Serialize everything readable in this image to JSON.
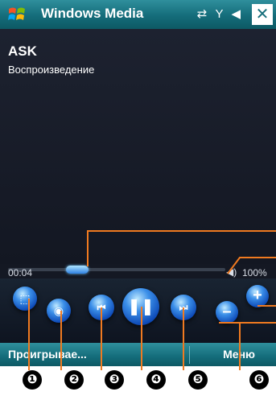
{
  "titlebar": {
    "title": "Windows Media",
    "start_icon": "windows-logo-icon",
    "status_icons": [
      "connectivity-icon",
      "signal-off-icon",
      "speaker-icon"
    ],
    "close_label": "✕"
  },
  "media": {
    "title": "ASK",
    "status": "Воспроизведение"
  },
  "seekbar": {
    "elapsed": "00:04",
    "position": 0.32
  },
  "volume": {
    "icon": "speaker-icon",
    "value": "100%"
  },
  "controls": [
    {
      "name": "fullscreen-icon",
      "glyph": "⬚"
    },
    {
      "name": "web-icon",
      "glyph": "◉"
    },
    {
      "name": "previous-track-icon",
      "glyph": "⏮"
    },
    {
      "name": "pause-icon",
      "glyph": "❚❚"
    },
    {
      "name": "next-track-icon",
      "glyph": "⏭"
    },
    {
      "name": "volume-down-icon",
      "glyph": "–"
    },
    {
      "name": "volume-up-icon",
      "glyph": "+"
    }
  ],
  "menubar": {
    "left": "Проигрывае...",
    "right": "Меню"
  },
  "callouts": [
    "❶",
    "❷",
    "❸",
    "❹",
    "❺",
    "❻"
  ],
  "colors": {
    "titlebar": "#146c7a",
    "accent_orange": "#f07a20",
    "button_blue": "#2f7fe0"
  }
}
